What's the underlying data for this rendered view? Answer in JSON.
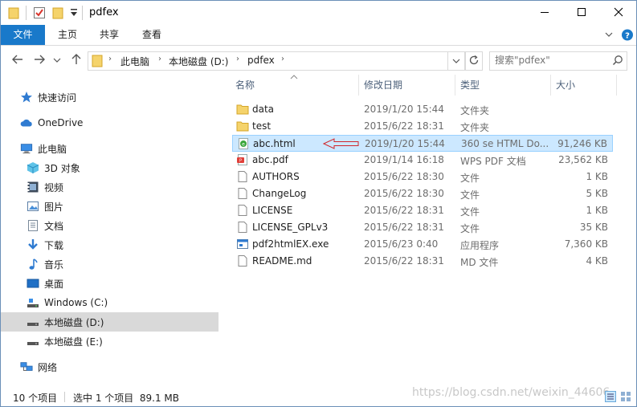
{
  "window": {
    "title": "pdfex",
    "accent": "#1979ca"
  },
  "ribbon": {
    "tabs": [
      "文件",
      "主页",
      "共享",
      "查看"
    ]
  },
  "address": {
    "crumbs": [
      "此电脑",
      "本地磁盘 (D:)",
      "pdfex"
    ]
  },
  "search": {
    "placeholder": "搜索\"pdfex\""
  },
  "nav": {
    "items": [
      {
        "label": "快速访问",
        "icon": "star-icon"
      },
      {
        "label": "OneDrive",
        "icon": "cloud-icon"
      },
      {
        "label": "此电脑",
        "icon": "computer-icon"
      },
      {
        "label": "3D 对象",
        "icon": "cube-icon"
      },
      {
        "label": "视频",
        "icon": "video-icon"
      },
      {
        "label": "图片",
        "icon": "picture-icon"
      },
      {
        "label": "文档",
        "icon": "document-icon"
      },
      {
        "label": "下载",
        "icon": "download-icon"
      },
      {
        "label": "音乐",
        "icon": "music-icon"
      },
      {
        "label": "桌面",
        "icon": "desktop-icon"
      },
      {
        "label": "Windows (C:)",
        "icon": "drive-icon"
      },
      {
        "label": "本地磁盘 (D:)",
        "icon": "drive-icon",
        "selected": true
      },
      {
        "label": "本地磁盘 (E:)",
        "icon": "drive-icon"
      },
      {
        "label": "网络",
        "icon": "network-icon"
      }
    ]
  },
  "columns": {
    "name": "名称",
    "date": "修改日期",
    "type": "类型",
    "size": "大小"
  },
  "files": [
    {
      "name": "data",
      "date": "2019/1/20 15:44",
      "type": "文件夹",
      "size": "",
      "icon": "folder-icon"
    },
    {
      "name": "test",
      "date": "2015/6/22 18:31",
      "type": "文件夹",
      "size": "",
      "icon": "folder-icon"
    },
    {
      "name": "abc.html",
      "date": "2019/1/20 15:44",
      "type": "360 se HTML Do...",
      "size": "91,246 KB",
      "icon": "html-file-icon",
      "selected": true
    },
    {
      "name": "abc.pdf",
      "date": "2019/1/14 16:18",
      "type": "WPS PDF 文档",
      "size": "23,562 KB",
      "icon": "pdf-file-icon"
    },
    {
      "name": "AUTHORS",
      "date": "2015/6/22 18:30",
      "type": "文件",
      "size": "1 KB",
      "icon": "file-icon"
    },
    {
      "name": "ChangeLog",
      "date": "2015/6/22 18:30",
      "type": "文件",
      "size": "5 KB",
      "icon": "file-icon"
    },
    {
      "name": "LICENSE",
      "date": "2015/6/22 18:31",
      "type": "文件",
      "size": "1 KB",
      "icon": "file-icon"
    },
    {
      "name": "LICENSE_GPLv3",
      "date": "2015/6/22 18:31",
      "type": "文件",
      "size": "35 KB",
      "icon": "file-icon"
    },
    {
      "name": "pdf2htmlEX.exe",
      "date": "2015/6/23 0:40",
      "type": "应用程序",
      "size": "7,360 KB",
      "icon": "exe-file-icon"
    },
    {
      "name": "README.md",
      "date": "2015/6/22 18:31",
      "type": "MD 文件",
      "size": "4 KB",
      "icon": "file-icon"
    }
  ],
  "status": {
    "count": "10 个项目",
    "selection": "选中 1 个项目  89.1 MB"
  },
  "watermark": "https://blog.csdn.net/weixin_44606"
}
